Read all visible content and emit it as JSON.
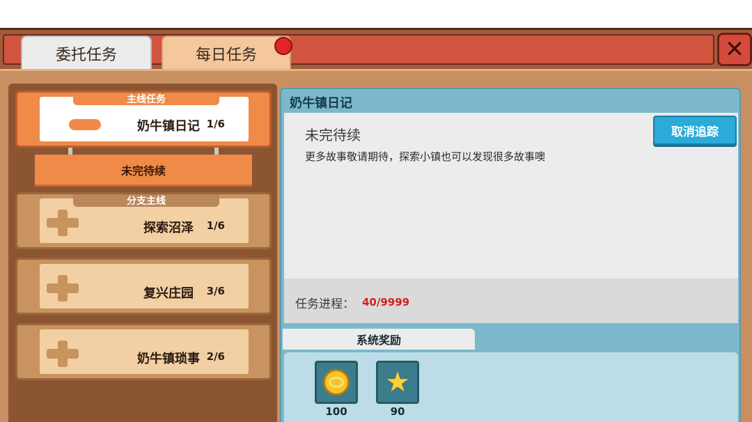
{
  "tabs": [
    {
      "label": "委托任务",
      "active": true
    },
    {
      "label": "每日任务",
      "active": false,
      "badge": true
    }
  ],
  "close_icon": "close-x-icon",
  "quests": [
    {
      "category": "主线任务",
      "name": "奶牛镇日记",
      "progress": "1/6",
      "expanded": true,
      "icon": "minus-icon"
    },
    {
      "category": "分支主线",
      "name": "探索沼泽",
      "progress": "1/6",
      "expanded": false,
      "icon": "plus-icon"
    },
    {
      "category": "",
      "name": "复兴庄园",
      "progress": "3/6",
      "expanded": false,
      "icon": "plus-icon"
    },
    {
      "category": "",
      "name": "奶牛镇琐事",
      "progress": "2/6",
      "expanded": false,
      "icon": "plus-icon"
    }
  ],
  "subquest": {
    "label": "未完待续"
  },
  "detail": {
    "title": "奶牛镇日记",
    "heading": "未完待续",
    "description": "更多故事敬请期待，探索小镇也可以发现很多故事噢",
    "untrack_label": "取消追踪",
    "progress_label": "任务进程：",
    "progress_value": "40/9999"
  },
  "rewards": {
    "tab_label": "系统奖励",
    "items": [
      {
        "icon": "gold-coin-icon",
        "amount": "100"
      },
      {
        "icon": "star-icon",
        "amount": "90"
      }
    ]
  },
  "colors": {
    "accent_orange": "#f08a48",
    "header_red": "#d1543f",
    "panel_blue": "#7cb8cc",
    "button_blue": "#2aabd8",
    "progress_red": "#d42020"
  }
}
